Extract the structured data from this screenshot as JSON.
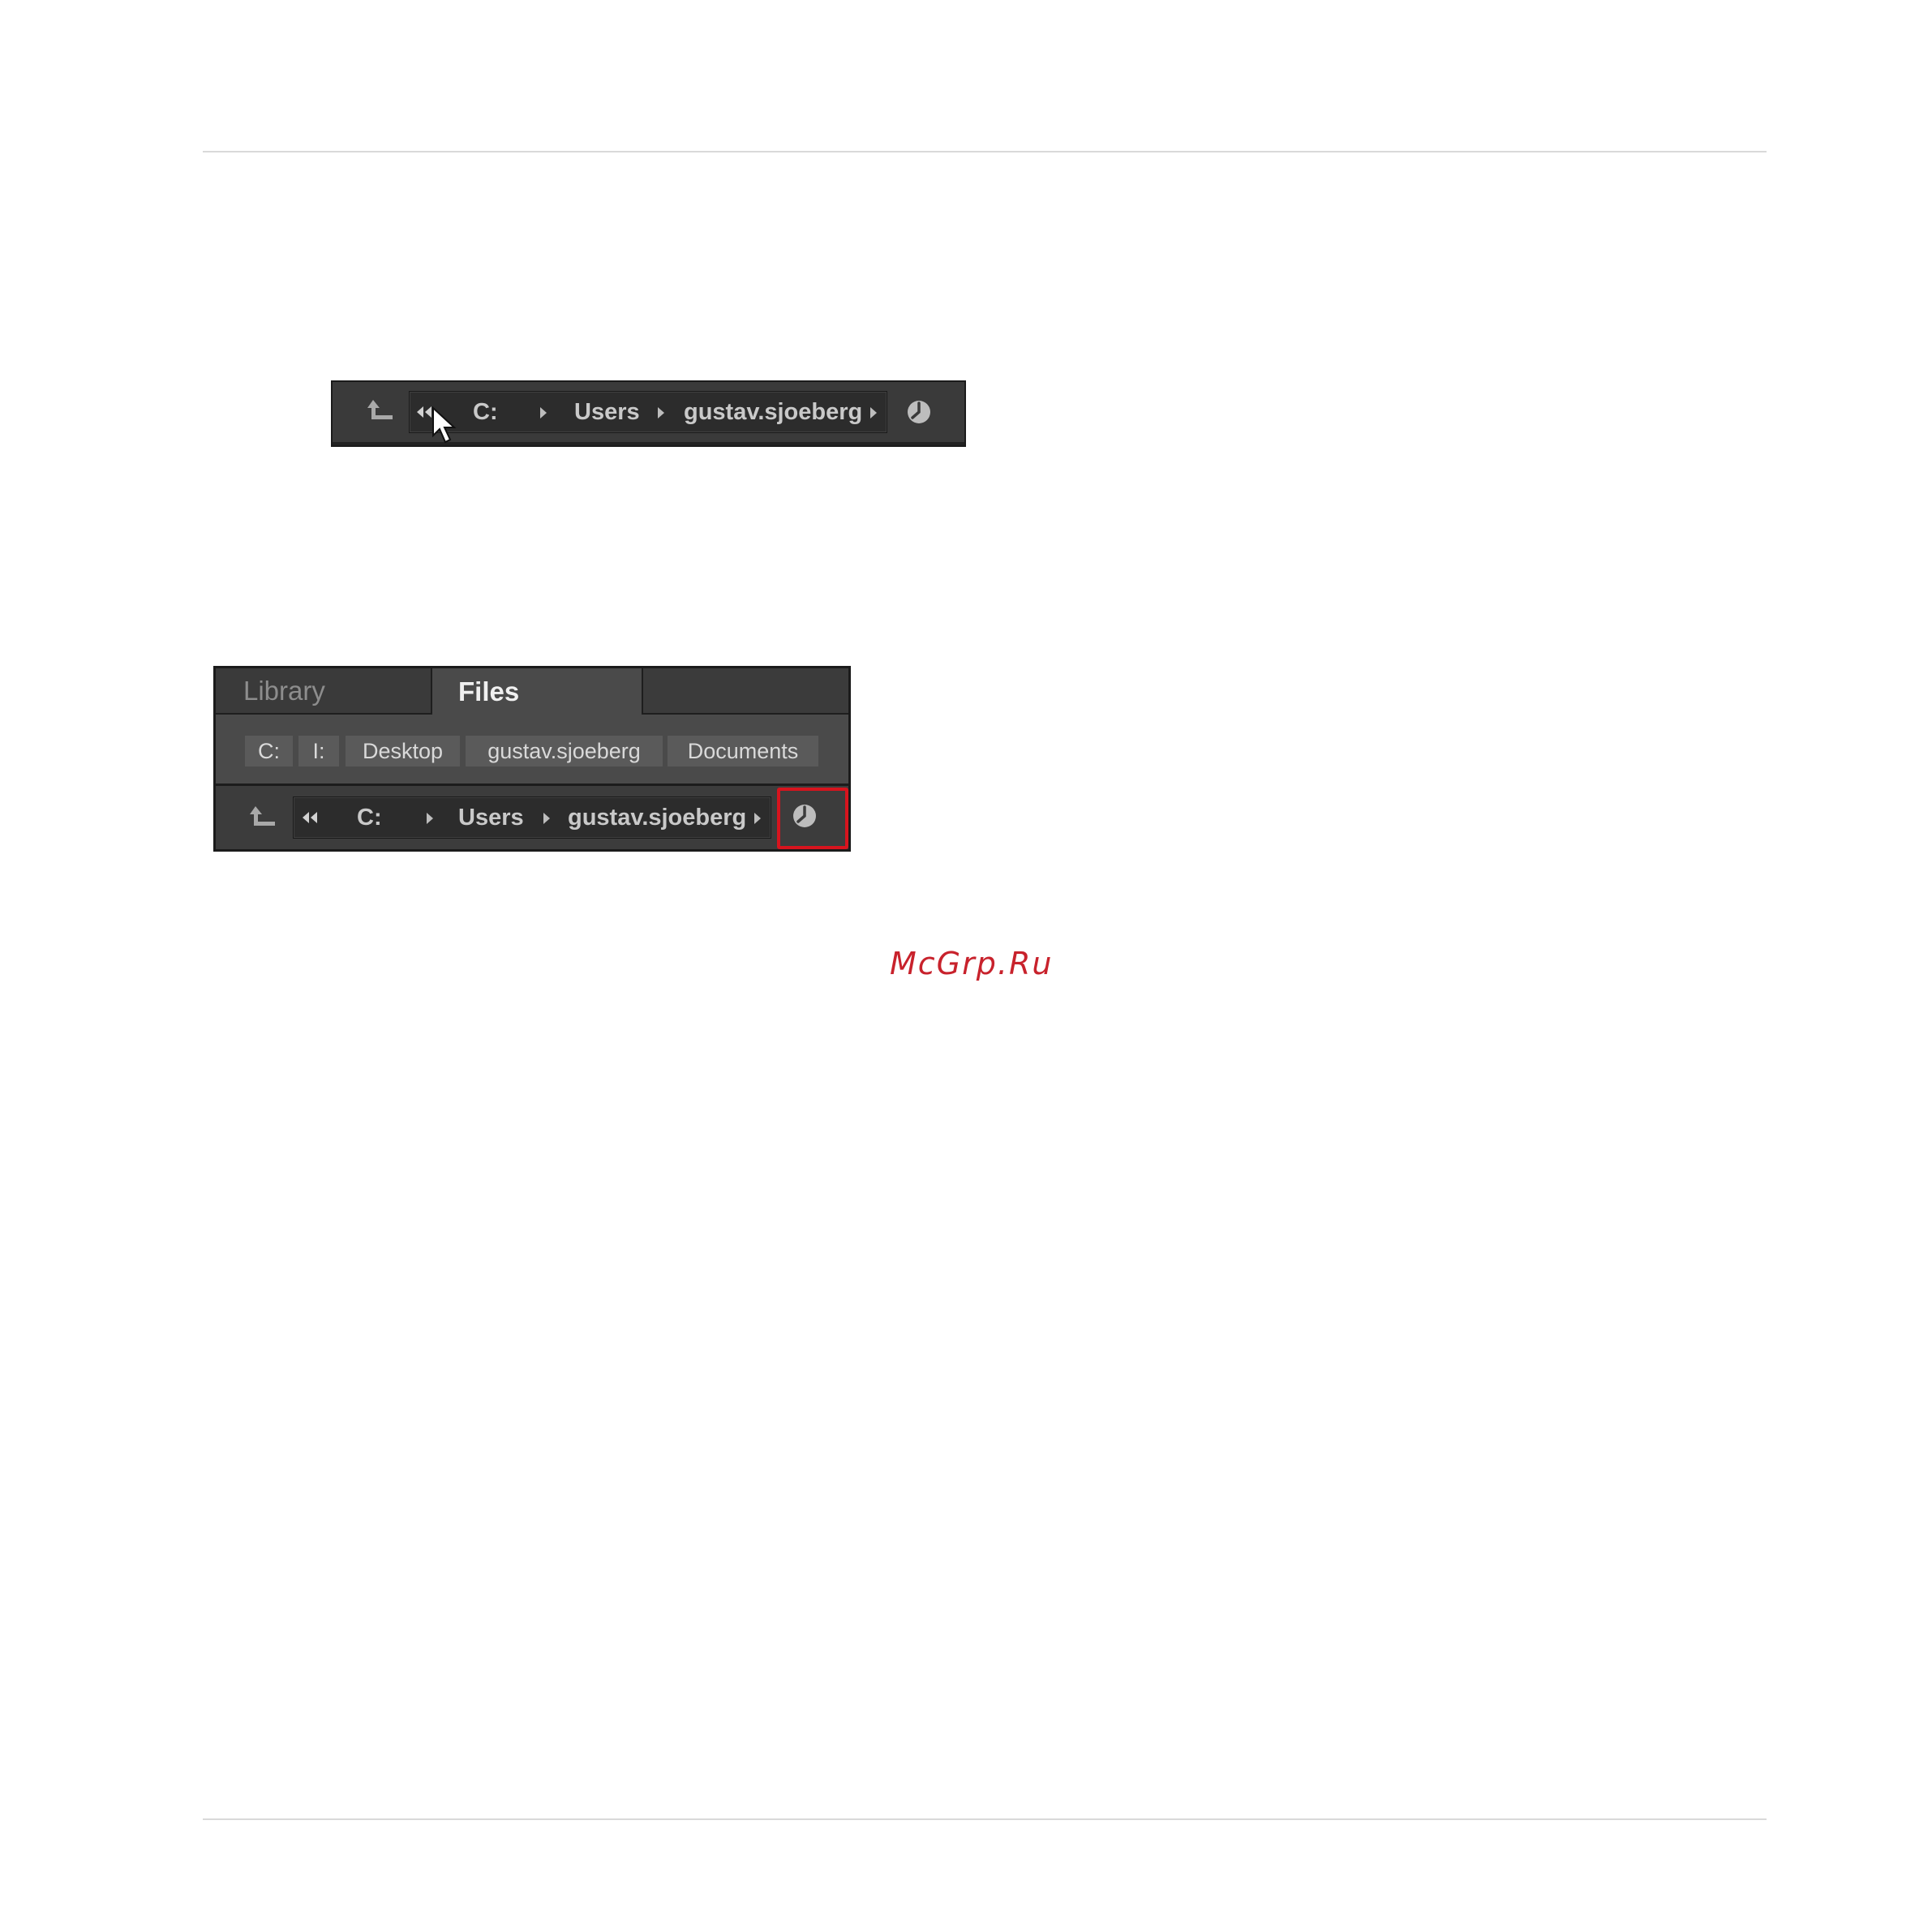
{
  "shot1": {
    "path": [
      "C:",
      "Users",
      "gustav.sjoeberg"
    ],
    "icons": [
      "up-arrow-icon",
      "back-double-arrow-icon",
      "mouse-pointer-icon",
      "clock-icon"
    ]
  },
  "shot2": {
    "tabs": {
      "library": "Library",
      "files": "Files"
    },
    "quick_locations": [
      "C:",
      "I:",
      "Desktop",
      "gustav.sjoeberg",
      "Documents"
    ],
    "path": [
      "C:",
      "Users",
      "gustav.sjoeberg"
    ],
    "highlight_color": "#d7141e"
  },
  "watermark": "McGrp.Ru"
}
